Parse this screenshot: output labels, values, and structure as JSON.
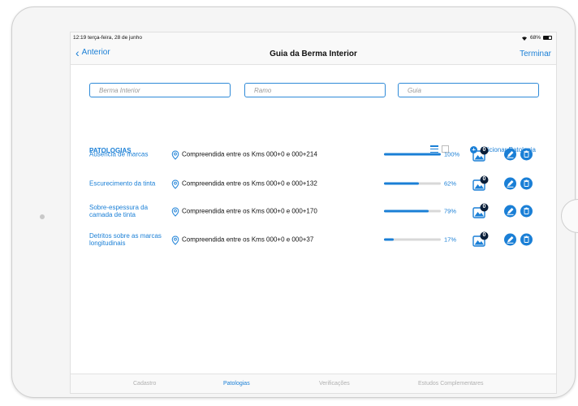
{
  "status": {
    "time": "12:19",
    "date": "terça-feira, 28 de junho",
    "battery": "68%"
  },
  "nav": {
    "back": "Anterior",
    "title": "Guia da Berma Interior",
    "done": "Terminar"
  },
  "fields": [
    {
      "placeholder": "Berma Interior"
    },
    {
      "placeholder": "Ramo"
    },
    {
      "placeholder": "Guia"
    }
  ],
  "section": {
    "title": "PATOLOGIAS",
    "add_label": "Adicionar Patologia"
  },
  "pathologies": [
    {
      "name": "Ausência de marcas",
      "location": "Compreendida entre os Kms 000+0 e 000+214",
      "progress": 1.0,
      "progress_label": "100%",
      "photo_count": "0"
    },
    {
      "name": "Escurecimento da tinta",
      "location": "Compreendida entre os Kms 000+0 e 000+132",
      "progress": 0.62,
      "progress_label": "62%",
      "photo_count": "0"
    },
    {
      "name": "Sobre-espessura da camada de tinta",
      "location": "Compreendida entre os Kms 000+0 e 000+170",
      "progress": 0.79,
      "progress_label": "79%",
      "photo_count": "0"
    },
    {
      "name": "Detritos sobre as marcas longitudinais",
      "location": "Compreendida entre os Kms 000+0 e 000+37",
      "progress": 0.17,
      "progress_label": "17%",
      "photo_count": "0"
    }
  ],
  "tabs": [
    {
      "label": "Cadastro",
      "active": false
    },
    {
      "label": "Patologias",
      "active": true
    },
    {
      "label": "Verificações",
      "active": false
    },
    {
      "label": "Estudos Complementares",
      "active": false
    }
  ],
  "colors": {
    "accent": "#1a7fd6",
    "muted": "#b0b0b0"
  }
}
